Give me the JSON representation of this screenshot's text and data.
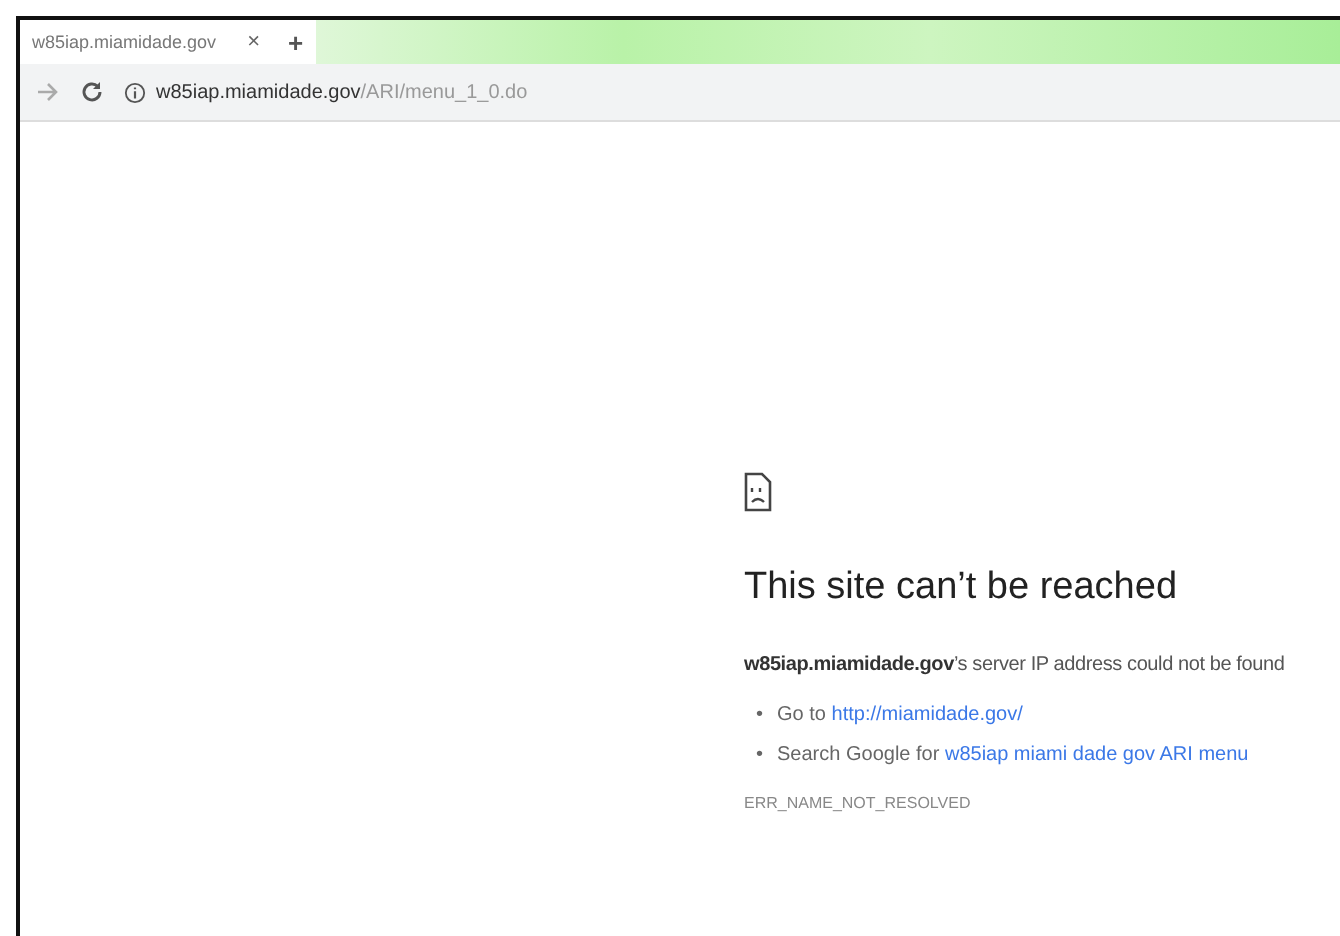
{
  "tab": {
    "title": "w85iap.miamidade.gov",
    "close": "×",
    "new_tab": "+"
  },
  "toolbar": {
    "url_host": "w85iap.miamidade.gov",
    "url_path": "/ARI/menu_1_0.do"
  },
  "error": {
    "title": "This site can’t be reached",
    "message": "**w85iap.miamidade.gov**’s server IP address could not be found",
    "suggestions": [
      {
        "bullet": "•",
        "text": "Go to",
        "link": "http://miamidade.gov/"
      },
      {
        "bullet": "•",
        "text": "Search Google for",
        "link": "w85iap miami dade gov ARI menu"
      }
    ],
    "code": "ERR_NAME_NOT_RESOLVED"
  }
}
